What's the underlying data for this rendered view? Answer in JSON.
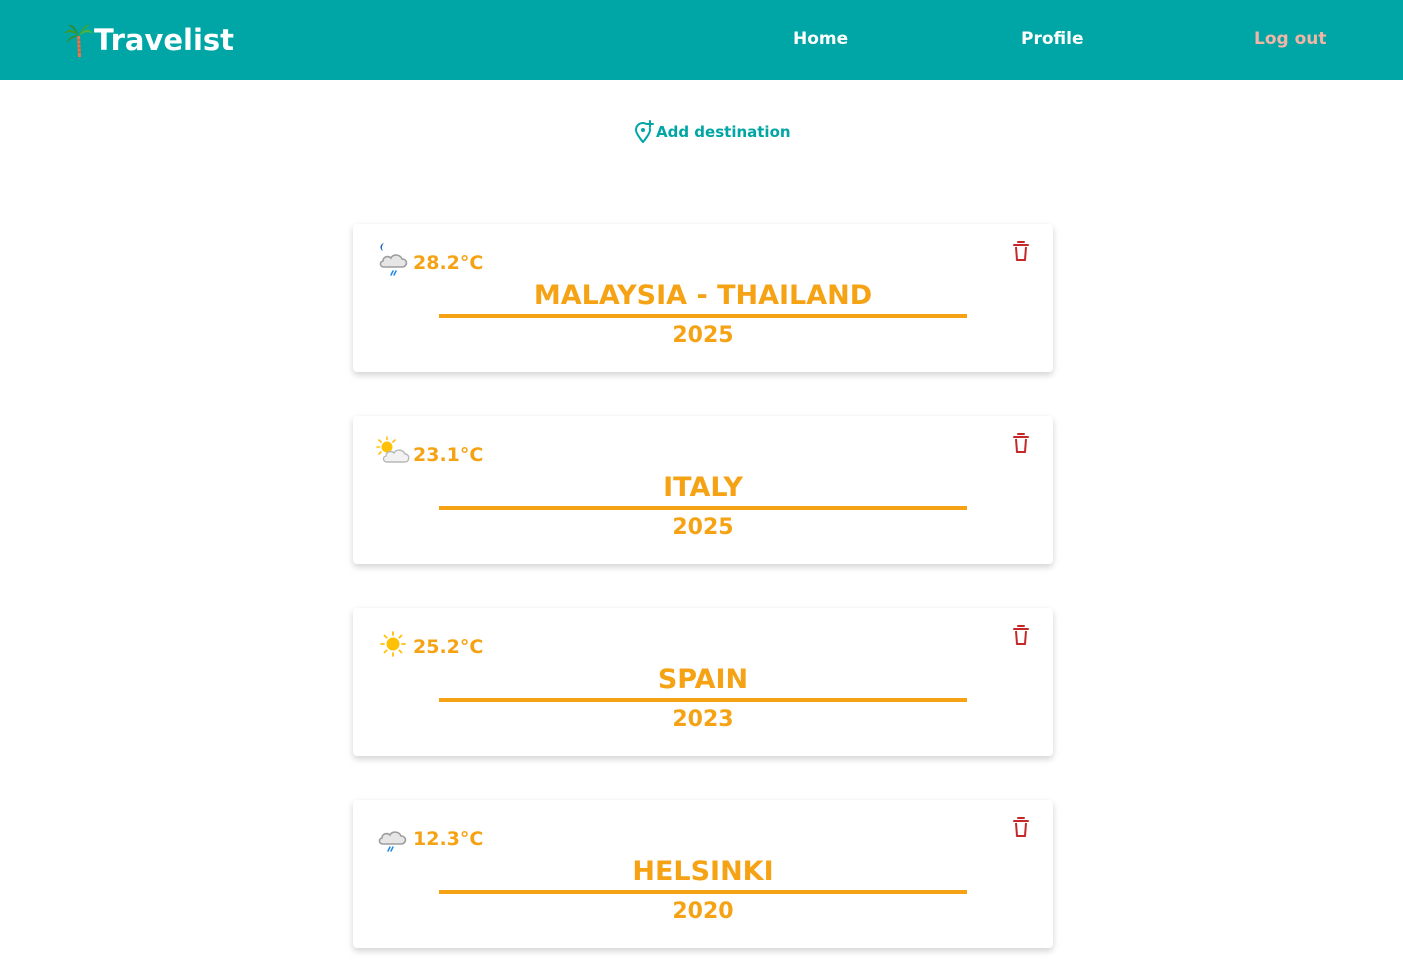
{
  "nav": {
    "brand": "Travelist",
    "links": {
      "home": "Home",
      "profile": "Profile",
      "logout": "Log out"
    }
  },
  "add_destination": {
    "label": "Add destination"
  },
  "colors": {
    "nav_bg": "#00a5a5",
    "accent": "#f5a315",
    "logout": "#f2b5a6",
    "delete": "#c62828"
  },
  "destinations": [
    {
      "weather_icon": "night-cloud-rain-icon",
      "temperature": "28.2°C",
      "name": "MALAYSIA - THAILAND",
      "year": "2025"
    },
    {
      "weather_icon": "sun-cloud-icon",
      "temperature": "23.1°C",
      "name": "ITALY",
      "year": "2025"
    },
    {
      "weather_icon": "sun-icon",
      "temperature": "25.2°C",
      "name": "SPAIN",
      "year": "2023"
    },
    {
      "weather_icon": "cloud-rain-icon",
      "temperature": "12.3°C",
      "name": "HELSINKI",
      "year": "2020"
    }
  ]
}
